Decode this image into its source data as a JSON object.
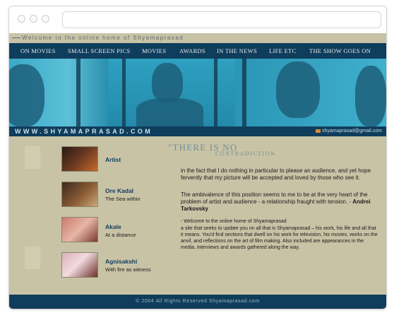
{
  "site": {
    "welcome": "Welcome to the online home of Shyamaprasad",
    "url_banner": "WWW.SHYAMAPRASAD.COM",
    "email": "shyamaprasad@gmail.com"
  },
  "nav": {
    "items": [
      {
        "label": "ON MOVIES"
      },
      {
        "label": "SMALL SCREEN PICS"
      },
      {
        "label": "MOVIES"
      },
      {
        "label": "AWARDS"
      },
      {
        "label": "IN THE NEWS"
      },
      {
        "label": "LIFE ETC"
      },
      {
        "label": "THE SHOW GOES ON"
      }
    ]
  },
  "sidebar": {
    "items": [
      {
        "title": "Artist",
        "subtitle": ""
      },
      {
        "title": "Ore Kadal",
        "subtitle": "The Sea within"
      },
      {
        "title": "Akale",
        "subtitle": "At a distance"
      },
      {
        "title": "Agnisakshi",
        "subtitle": "With fire as witness"
      }
    ]
  },
  "main": {
    "quote_title": "\"THERE IS NO",
    "quote_sub": "CONTRADICTION",
    "para1": "in the fact that I do nothing in particular to please an audience, and yet hope fervently that my picture will be accepted and loved by those who see it.",
    "para2_text": "The ambivalence of this position seems to me to be at the very heart of the problem of artist and audience - a relationship fraught with tension. - ",
    "para2_author": "Andrei Tarkovsky",
    "intro_heading": "-   Welcome to the online home of Shyamaprasad",
    "intro_body": "a site that seeks to update you on all that is Shyamaprasad – his work, his life and all that it means. You'd find sections that dwell on his work for television, his movies, works on the anvil, and reflections on the art of film making. Also included are appearances in the media, interviews and awards gathered along the way."
  },
  "footer": {
    "text": "© 2004 All Rights Reserved Shyamaprasad.com"
  },
  "colors": {
    "nav_bg": "#0f3d5c",
    "page_bg": "#c9c3a6",
    "hero_blue": "#2aa3c3",
    "link": "#0f3d5c"
  }
}
